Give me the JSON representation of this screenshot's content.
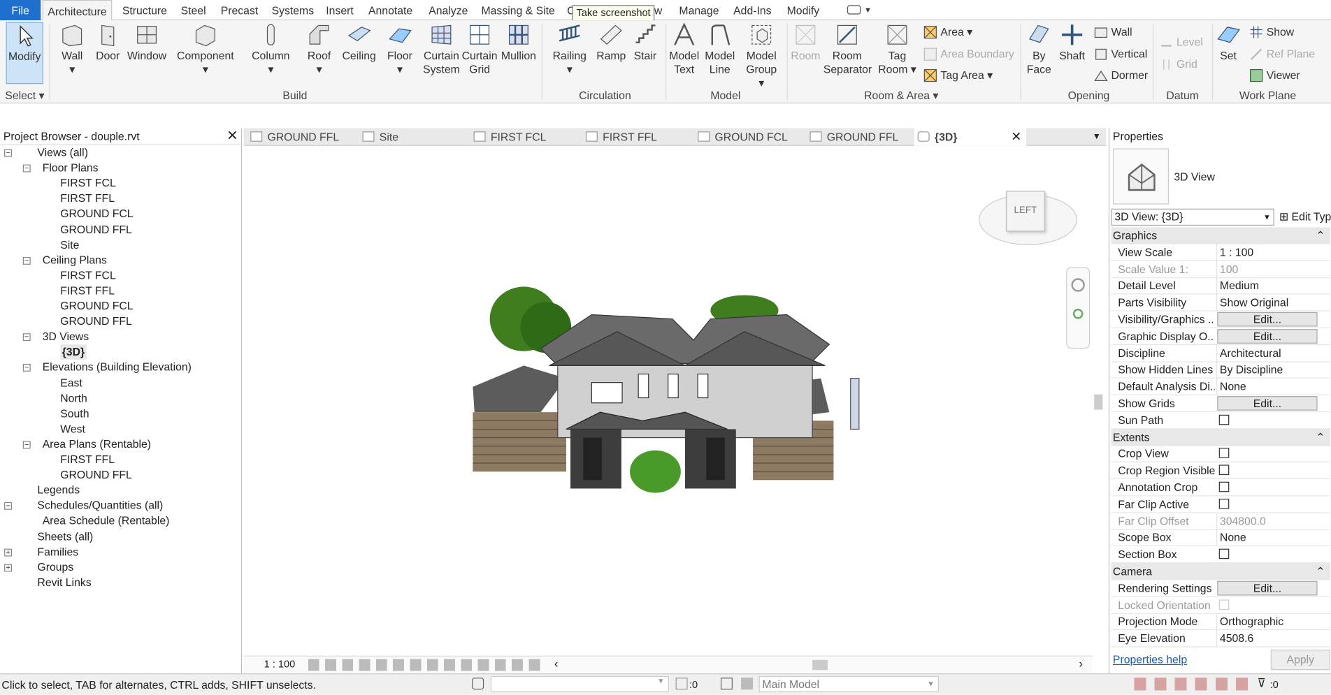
{
  "menu": {
    "file": "File",
    "tabs": [
      "Architecture",
      "Structure",
      "Steel",
      "Precast",
      "Systems",
      "Insert",
      "Annotate",
      "Analyze",
      "Massing & Site",
      "Collaborate",
      "View",
      "Manage",
      "Add-Ins",
      "Modify"
    ],
    "tooltip": "Take screenshot"
  },
  "ribbon": {
    "select": {
      "modify": "Modify",
      "panel": "Select"
    },
    "build": {
      "wall": "Wall",
      "door": "Door",
      "window": "Window",
      "component": "Component",
      "column": "Column",
      "roof": "Roof",
      "ceiling": "Ceiling",
      "floor": "Floor",
      "curtain_system": "Curtain System",
      "curtain_grid": "Curtain Grid",
      "mullion": "Mullion",
      "panel": "Build"
    },
    "circulation": {
      "railing": "Railing",
      "ramp": "Ramp",
      "stair": "Stair",
      "panel": "Circulation"
    },
    "model": {
      "model_text": "Model Text",
      "model_line": "Model Line",
      "model_group": "Model Group",
      "panel": "Model"
    },
    "room": {
      "room": "Room",
      "separator": "Room Separator",
      "tag_room": "Tag Room",
      "area": "Area",
      "area_boundary": "Area Boundary",
      "tag_area": "Tag Area",
      "panel": "Room & Area"
    },
    "opening": {
      "by_face": "By Face",
      "shaft": "Shaft",
      "wall": "Wall",
      "vertical": "Vertical",
      "dormer": "Dormer",
      "panel": "Opening"
    },
    "datum": {
      "level": "Level",
      "grid": "Grid",
      "panel": "Datum"
    },
    "workplane": {
      "set": "Set",
      "show": "Show",
      "ref_plane": "Ref Plane",
      "viewer": "Viewer",
      "panel": "Work Plane"
    }
  },
  "browser": {
    "title": "Project Browser - douple.rvt",
    "items": [
      "Views (all)",
      "Floor Plans",
      "FIRST FCL",
      "FIRST FFL",
      "GROUND FCL",
      "GROUND FFL",
      "Site",
      "Ceiling Plans",
      "FIRST FCL",
      "FIRST FFL",
      "GROUND FCL",
      "GROUND FFL",
      "3D Views",
      "{3D}",
      "Elevations (Building Elevation)",
      "East",
      "North",
      "South",
      "West",
      "Area Plans (Rentable)",
      "FIRST FFL",
      "GROUND FFL",
      "Legends",
      "Schedules/Quantities (all)",
      "Area Schedule (Rentable)",
      "Sheets (all)",
      "Families",
      "Groups",
      "Revit Links"
    ]
  },
  "view": {
    "tabs": [
      "GROUND FFL",
      "Site",
      "FIRST FCL",
      "FIRST FFL",
      "GROUND FCL",
      "GROUND FFL",
      "{3D}"
    ],
    "cube": "LEFT",
    "scale": "1 : 100"
  },
  "props": {
    "title": "Properties",
    "type": "3D View",
    "selector": "3D View: {3D}",
    "edit_type": "Edit Type",
    "sections": [
      "Graphics",
      "Extents",
      "Camera"
    ],
    "rows": [
      {
        "k": "View Scale",
        "v": "1 : 100"
      },
      {
        "k": "Scale Value    1:",
        "v": "100"
      },
      {
        "k": "Detail Level",
        "v": "Medium"
      },
      {
        "k": "Parts Visibility",
        "v": "Show Original"
      },
      {
        "k": "Visibility/Graphics ...",
        "v": "Edit..."
      },
      {
        "k": "Graphic Display O...",
        "v": "Edit..."
      },
      {
        "k": "Discipline",
        "v": "Architectural"
      },
      {
        "k": "Show Hidden Lines",
        "v": "By Discipline"
      },
      {
        "k": "Default Analysis Di...",
        "v": "None"
      },
      {
        "k": "Show Grids",
        "v": "Edit..."
      },
      {
        "k": "Sun Path",
        "v": ""
      },
      {
        "k": "Crop View",
        "v": ""
      },
      {
        "k": "Crop Region Visible",
        "v": ""
      },
      {
        "k": "Annotation Crop",
        "v": ""
      },
      {
        "k": "Far Clip Active",
        "v": ""
      },
      {
        "k": "Far Clip Offset",
        "v": "304800.0"
      },
      {
        "k": "Scope Box",
        "v": "None"
      },
      {
        "k": "Section Box",
        "v": ""
      },
      {
        "k": "Rendering Settings",
        "v": "Edit..."
      },
      {
        "k": "Locked Orientation",
        "v": ""
      },
      {
        "k": "Projection Mode",
        "v": "Orthographic"
      },
      {
        "k": "Eye Elevation",
        "v": "4508.6"
      }
    ],
    "help": "Properties help",
    "apply": "Apply"
  },
  "status": {
    "hint": "Click to select, TAB for alternates, CTRL adds, SHIFT unselects.",
    "zero": ":0",
    "model": "Main Model",
    "filter": ":0"
  }
}
